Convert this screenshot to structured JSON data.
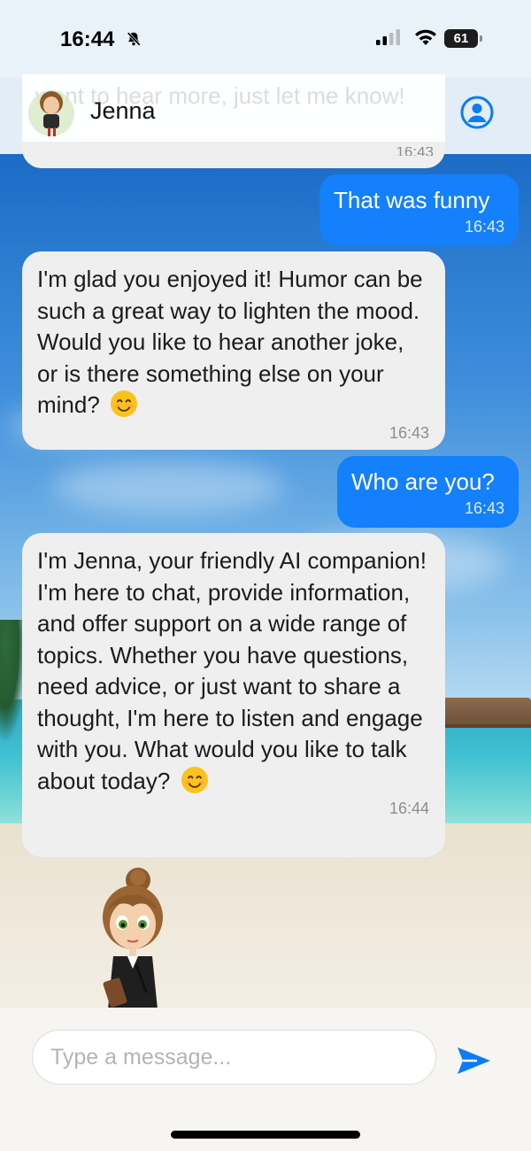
{
  "status_bar": {
    "time": "16:44",
    "battery_level": "61",
    "icons": [
      "bell-off-icon",
      "signal-icon",
      "wifi-icon",
      "battery-icon"
    ]
  },
  "header": {
    "name": "Jenna",
    "scrolled_text": "want to hear more, just let me know!",
    "avatar_icon": "jenna-avatar-icon",
    "profile_icon": "user-circle-icon"
  },
  "messages": [
    {
      "id": "prev",
      "sender": "bot",
      "text": "",
      "time": "16:43"
    },
    {
      "id": "m1",
      "sender": "user",
      "text": "That was funny",
      "time": "16:43"
    },
    {
      "id": "m2",
      "sender": "bot",
      "text": "I'm glad you enjoyed it! Humor can be such a great way to lighten the mood. Would you like to hear another joke, or is there something else on your mind?",
      "emoji": "smiling-face-icon",
      "time": "16:43"
    },
    {
      "id": "m3",
      "sender": "user",
      "text": "Who are you?",
      "time": "16:43"
    },
    {
      "id": "m4",
      "sender": "bot",
      "text": "I'm Jenna, your friendly AI companion! I'm here to chat, provide information, and offer support on a wide range of topics. Whether you have questions, need advice, or just want to share a thought, I'm here to listen and engage with you. What would you like to talk about today?",
      "emoji": "smiling-face-icon",
      "time": "16:44"
    }
  ],
  "input": {
    "placeholder": "Type a message...",
    "value": ""
  },
  "colors": {
    "user_bubble": "#1480fb",
    "bot_bubble": "#efefef",
    "accent": "#0a7cf5"
  }
}
